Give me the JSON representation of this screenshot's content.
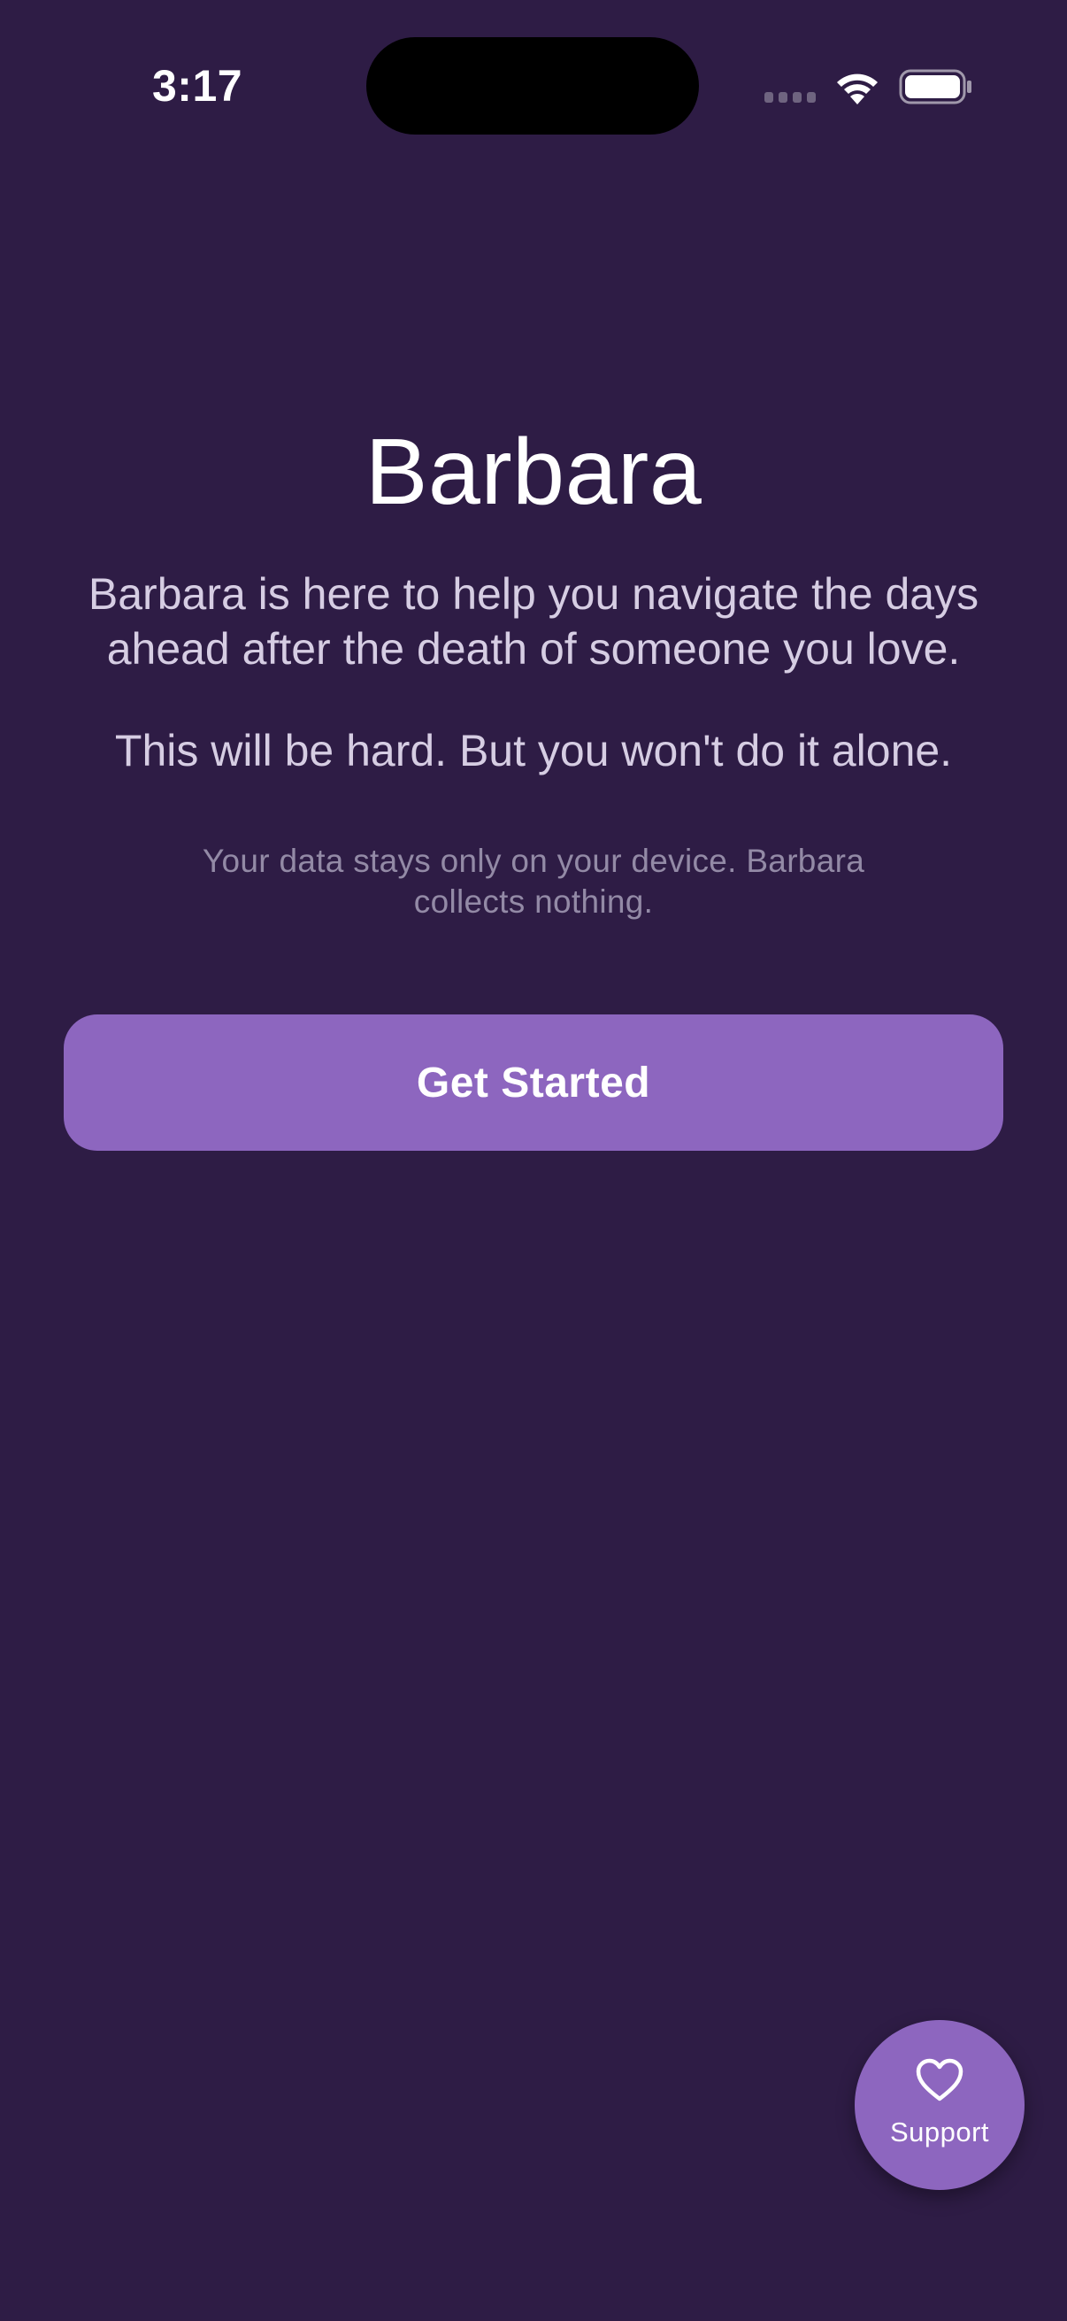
{
  "status_bar": {
    "time": "3:17"
  },
  "welcome": {
    "title": "Barbara",
    "intro": "Barbara is here to help you navigate the days ahead after the death of someone you love.",
    "reassurance": "This will be hard. But you won't do it alone.",
    "privacy_note": "Your data stays only on your device. Barbara collects nothing.",
    "cta_label": "Get Started"
  },
  "support_button": {
    "label": "Support",
    "icon": "heart-icon"
  },
  "colors": {
    "background": "#2e1c45",
    "accent": "#8d66bf",
    "body_text": "#d6cde3",
    "muted_text": "#938aa6"
  }
}
